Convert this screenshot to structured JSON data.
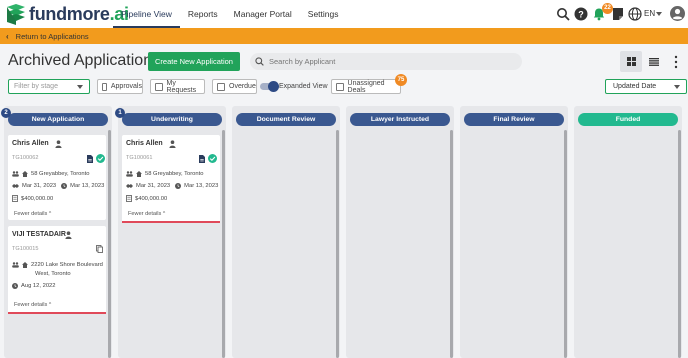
{
  "app": {
    "logo_name": "fundmore",
    "logo_suffix": ".ai",
    "brand_color": "#21a35a",
    "nav": [
      {
        "label": "Pipeline View",
        "active": true
      },
      {
        "label": "Reports"
      },
      {
        "label": "Manager Portal"
      },
      {
        "label": "Settings"
      }
    ],
    "notification_count": "22",
    "language": "EN"
  },
  "return_bar": {
    "label": "Return to Applications",
    "color": "#f29b1d"
  },
  "page": {
    "title": "Archived Applications",
    "create_label": "Create New Application",
    "search_placeholder": "Search by Applicant"
  },
  "filters": {
    "stage_placeholder": "Filter by stage",
    "approvals": "Approvals",
    "my_requests": "My Requests",
    "overdue": "Overdue",
    "expanded_view": "Expanded View",
    "unassigned_deals": "Unassigned Deals",
    "unassigned_count": "75",
    "sort_value": "Updated Date"
  },
  "columns": [
    {
      "title": "New Application",
      "count": "2"
    },
    {
      "title": "Underwriting",
      "count": "1"
    },
    {
      "title": "Document Review"
    },
    {
      "title": "Lawyer Instructed"
    },
    {
      "title": "Final Review"
    },
    {
      "title": "Funded"
    }
  ],
  "cards": {
    "c1": {
      "name": "Chris Allen",
      "id": "TG100062",
      "address": "58 Greyabbey, Toronto",
      "date1": "Mar 31, 2023",
      "date2": "Mar 13, 2023",
      "amount": "$400,000.00",
      "link": "Fewer details"
    },
    "c2": {
      "name": "VIJI TESTADAIR",
      "id": "TG100015",
      "address1": "2220 Lake Shore Boulevard",
      "address2": "West, Toronto",
      "date1": "Aug 12, 2022",
      "link": "Fewer details"
    },
    "c3": {
      "name": "Chris Allen",
      "id": "TG100061",
      "address": "58 Greyabbey, Toronto",
      "date1": "Mar 31, 2023",
      "date2": "Mar 13, 2023",
      "amount": "$400,000.00",
      "link": "Fewer details"
    }
  },
  "icons": [
    "search-icon",
    "help-icon",
    "bell-icon",
    "note-icon",
    "globe-icon",
    "account-icon",
    "grid-view-icon",
    "list-view-icon",
    "more-vert-icon"
  ]
}
